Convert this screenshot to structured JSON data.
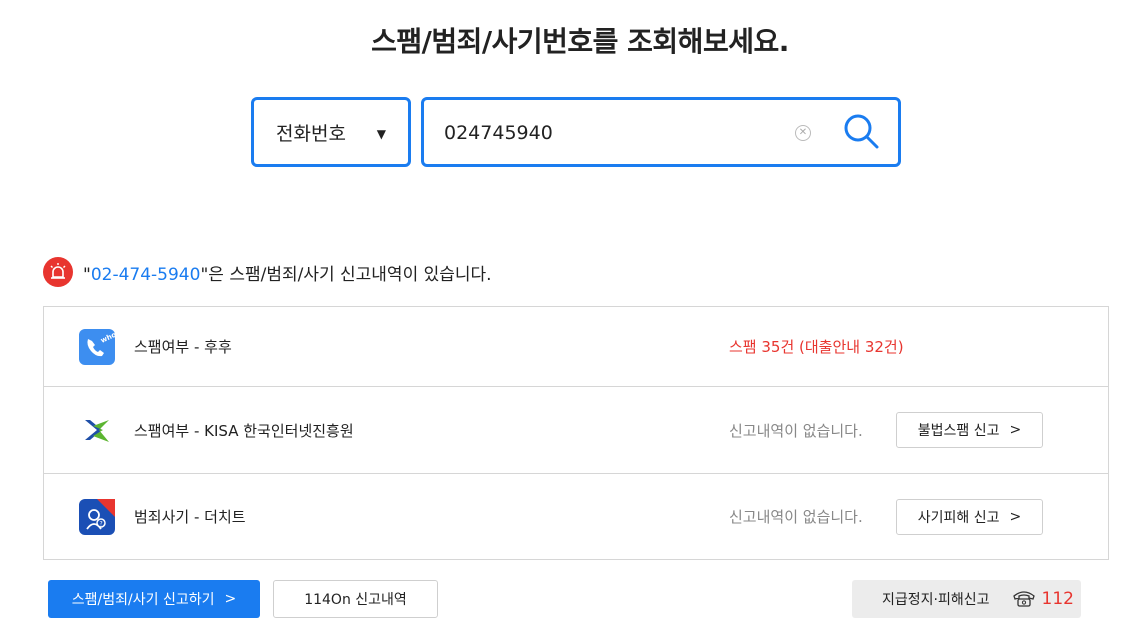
{
  "title": "스팸/범죄/사기번호를 조회해보세요.",
  "search": {
    "type_label": "전화번호",
    "query_value": "024745940"
  },
  "result": {
    "quote_open": "\"",
    "phone_number": "02-474-5940",
    "message_suffix": "\"은 스팸/범죄/사기 신고내역이 있습니다."
  },
  "rows": [
    {
      "label": "스팸여부 - 후후",
      "status": "스팸 35건 (대출안내 32건)",
      "status_color": "#e8352f"
    },
    {
      "label": "스팸여부 - KISA 한국인터넷진흥원",
      "status": "신고내역이 없습니다.",
      "button": "불법스팸 신고"
    },
    {
      "label": "범죄사기 - 더치트",
      "status": "신고내역이 없습니다.",
      "button": "사기피해 신고"
    }
  ],
  "bottom": {
    "primary_button": "스팸/범죄/사기 신고하기",
    "secondary_button": "114On 신고내역",
    "hotline_label": "지급정지·피해신고",
    "hotline_number": "112"
  },
  "colors": {
    "accent": "#1a7cf0",
    "alert": "#e8352f"
  },
  "icons": [
    "alarm-icon",
    "whowho-logo-icon",
    "kisa-logo-icon",
    "thecheat-logo-icon",
    "search-icon",
    "clear-icon",
    "phone-icon",
    "chevron-right-icon",
    "caret-down-icon"
  ]
}
